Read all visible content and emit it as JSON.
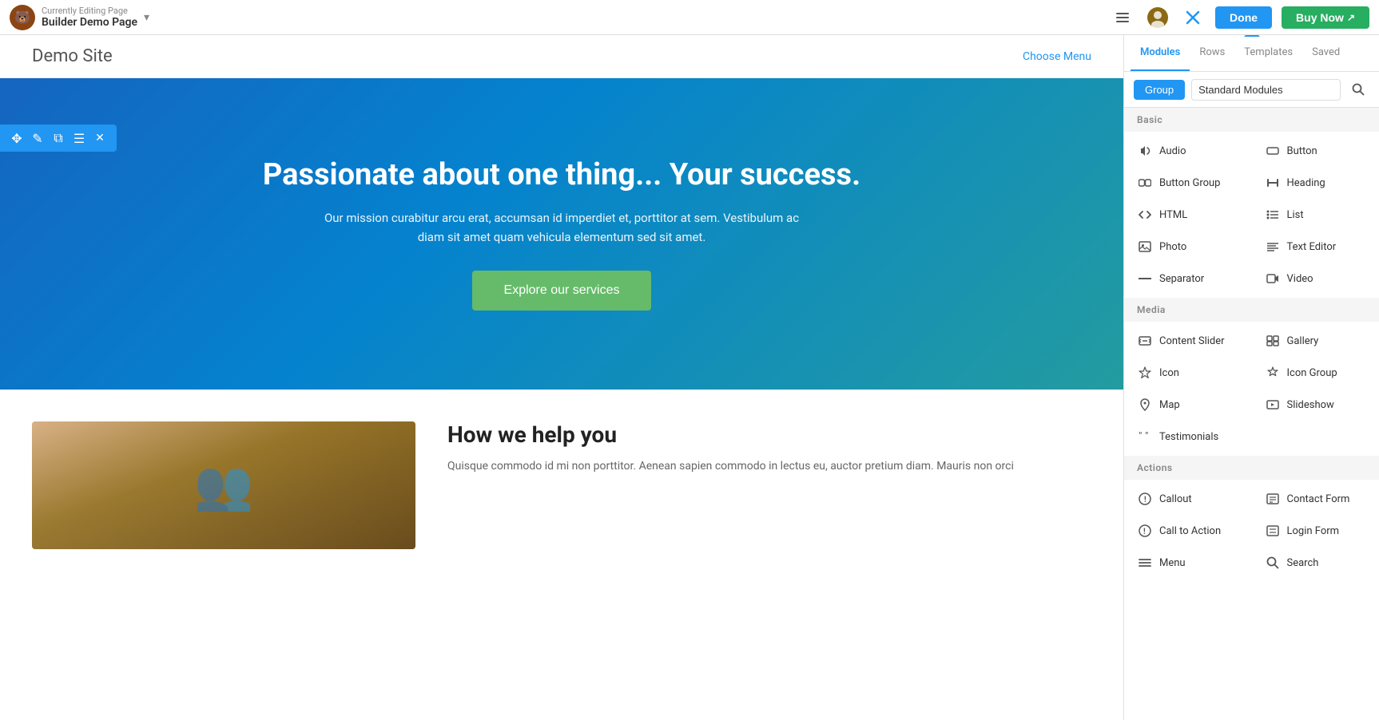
{
  "topbar": {
    "subtitle": "Currently Editing Page",
    "title": "Builder Demo Page",
    "done_label": "Done",
    "buy_now_label": "Buy Now"
  },
  "site": {
    "title": "Demo Site",
    "choose_menu": "Choose Menu"
  },
  "hero": {
    "heading": "Passionate about one thing... Your success.",
    "subtext": "Our mission curabitur arcu erat, accumsan id imperdiet et, porttitor at sem. Vestibulum ac diam sit amet quam vehicula elementum sed sit amet.",
    "button_label": "Explore our services"
  },
  "content": {
    "heading": "How we help you",
    "body": "Quisque commodo id mi non porttitor. Aenean sapien commodo in lectus eu, auctor pretium diam. Mauris non orci"
  },
  "panel": {
    "tabs": [
      {
        "label": "Modules",
        "active": true
      },
      {
        "label": "Rows",
        "active": false
      },
      {
        "label": "Templates",
        "active": false
      },
      {
        "label": "Saved",
        "active": false
      }
    ],
    "group_label": "Group",
    "module_group": "Standard Modules",
    "sections": [
      {
        "name": "Basic",
        "modules": [
          {
            "icon": "♪",
            "label": "Audio"
          },
          {
            "icon": "⬜",
            "label": "Button"
          },
          {
            "icon": "⬜",
            "label": "Button Group"
          },
          {
            "icon": "≡",
            "label": "Heading"
          },
          {
            "icon": "<>",
            "label": "HTML"
          },
          {
            "icon": "☰",
            "label": "List"
          },
          {
            "icon": "⬜",
            "label": "Photo"
          },
          {
            "icon": "≡",
            "label": "Text Editor"
          },
          {
            "icon": "—",
            "label": "Separator"
          },
          {
            "icon": "▶",
            "label": "Video"
          }
        ]
      },
      {
        "name": "Media",
        "modules": [
          {
            "icon": "▭",
            "label": "Content Slider"
          },
          {
            "icon": "⊞",
            "label": "Gallery"
          },
          {
            "icon": "★",
            "label": "Icon"
          },
          {
            "icon": "★",
            "label": "Icon Group"
          },
          {
            "icon": "◎",
            "label": "Map"
          },
          {
            "icon": "▶",
            "label": "Slideshow"
          },
          {
            "icon": "❝",
            "label": "Testimonials"
          }
        ]
      },
      {
        "name": "Actions",
        "modules": [
          {
            "icon": "📣",
            "label": "Callout"
          },
          {
            "icon": "☰",
            "label": "Contact Form"
          },
          {
            "icon": "📣",
            "label": "Call to Action"
          },
          {
            "icon": "☰",
            "label": "Login Form"
          },
          {
            "icon": "☰",
            "label": "Menu"
          },
          {
            "icon": "🔍",
            "label": "Search"
          }
        ]
      }
    ]
  }
}
